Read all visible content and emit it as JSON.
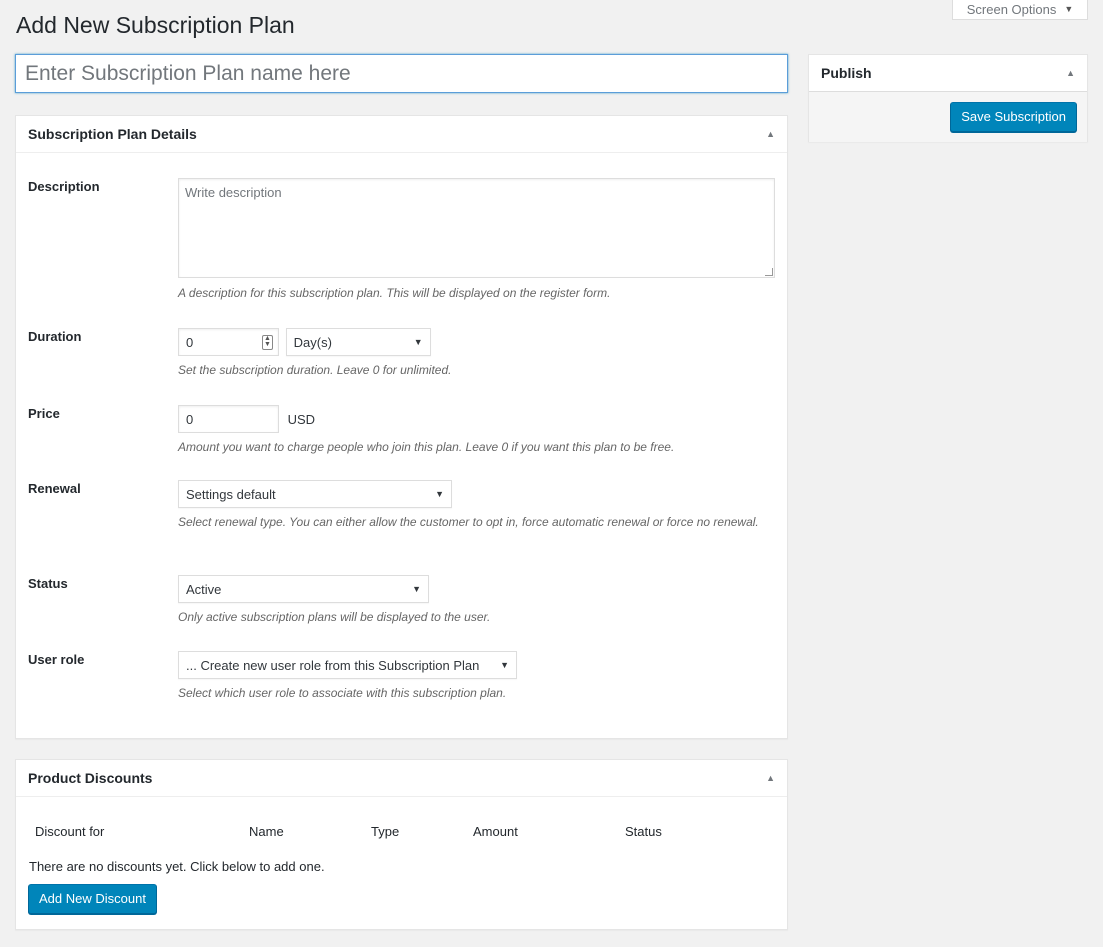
{
  "header": {
    "screen_options_label": "Screen Options",
    "page_title": "Add New Subscription Plan",
    "title_placeholder": "Enter Subscription Plan name here"
  },
  "details": {
    "title": "Subscription Plan Details",
    "description": {
      "label": "Description",
      "placeholder": "Write description",
      "help": "A description for this subscription plan. This will be displayed on the register form."
    },
    "duration": {
      "label": "Duration",
      "value": "0",
      "unit": "Day(s)",
      "help": "Set the subscription duration. Leave 0 for unlimited."
    },
    "price": {
      "label": "Price",
      "value": "0",
      "currency": "USD",
      "help": "Amount you want to charge people who join this plan. Leave 0 if you want this plan to be free."
    },
    "renewal": {
      "label": "Renewal",
      "value": "Settings default",
      "help": "Select renewal type. You can either allow the customer to opt in, force automatic renewal or force no renewal."
    },
    "status": {
      "label": "Status",
      "value": "Active",
      "help": "Only active subscription plans will be displayed to the user."
    },
    "user_role": {
      "label": "User role",
      "value": "... Create new user role from this Subscription Plan",
      "help": "Select which user role to associate with this subscription plan."
    }
  },
  "discounts": {
    "title": "Product Discounts",
    "columns": [
      "Discount for",
      "Name",
      "Type",
      "Amount",
      "Status"
    ],
    "empty_message": "There are no discounts yet. Click below to add one.",
    "add_button": "Add New Discount"
  },
  "publish": {
    "title": "Publish",
    "save_button": "Save Subscription"
  },
  "colors": {
    "primary_button": "#0085ba",
    "background": "#f1f1f1",
    "focus_border": "#5b9dd9"
  }
}
